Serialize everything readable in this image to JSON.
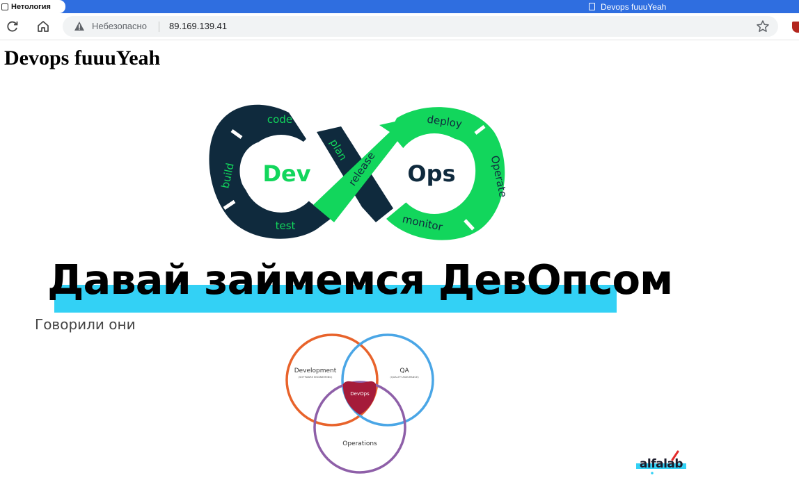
{
  "browser": {
    "tabs": [
      {
        "label": "Нетология",
        "active": false
      },
      {
        "label": "Devops fuuuYeah",
        "active": true
      }
    ],
    "security_label": "Небезопасно",
    "url": "89.169.139.41",
    "colors": {
      "tabbar": "#2f6ee0",
      "omnibox": "#f1f3f4"
    }
  },
  "page": {
    "heading": "Devops fuuuYeah",
    "banner": {
      "infinity": {
        "left_word": "Dev",
        "right_word": "Ops",
        "stages_left": [
          "code",
          "build",
          "test",
          "plan"
        ],
        "stages_right": [
          "deploy",
          "Operate",
          "monitor",
          "release"
        ],
        "colors": {
          "dark": "#0f2a3d",
          "green": "#12d65c"
        }
      },
      "headline": "Давай займемся ДевОпсом",
      "subhead": "Говорили они",
      "venn": {
        "development": "Development",
        "development_sub": "(SOFTWARE ENGINEERING)",
        "qa": "QA",
        "qa_sub": "(QUALITY ASSURANCE)",
        "operations": "Operations",
        "center": "DevOps",
        "colors": {
          "development": "#e8632b",
          "qa": "#4aa6e6",
          "operations": "#8e5fa8",
          "center": "#a51b3a"
        }
      },
      "logo": "alfalab"
    }
  }
}
